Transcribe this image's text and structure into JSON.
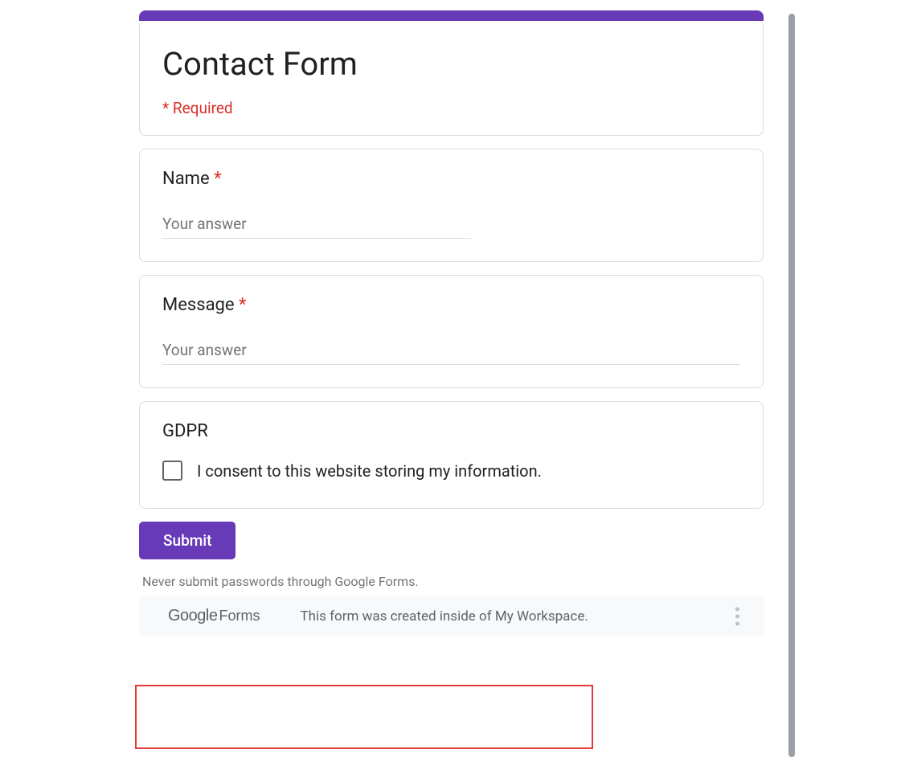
{
  "accent_color": "#673ab7",
  "required_color": "#d93025",
  "header": {
    "title": "Contact Form",
    "required_note": "* Required"
  },
  "questions": {
    "name": {
      "label": "Name",
      "required_mark": "*",
      "placeholder": "Your answer"
    },
    "message": {
      "label": "Message",
      "required_mark": "*",
      "placeholder": "Your answer"
    },
    "gdpr": {
      "label": "GDPR",
      "checkbox_label": "I consent to this website storing my information."
    }
  },
  "submit_label": "Submit",
  "footer": {
    "warning": "Never submit passwords through Google Forms.",
    "logo_google": "Google",
    "logo_forms": "Forms",
    "workspace_note": "This form was created inside of My Workspace."
  }
}
